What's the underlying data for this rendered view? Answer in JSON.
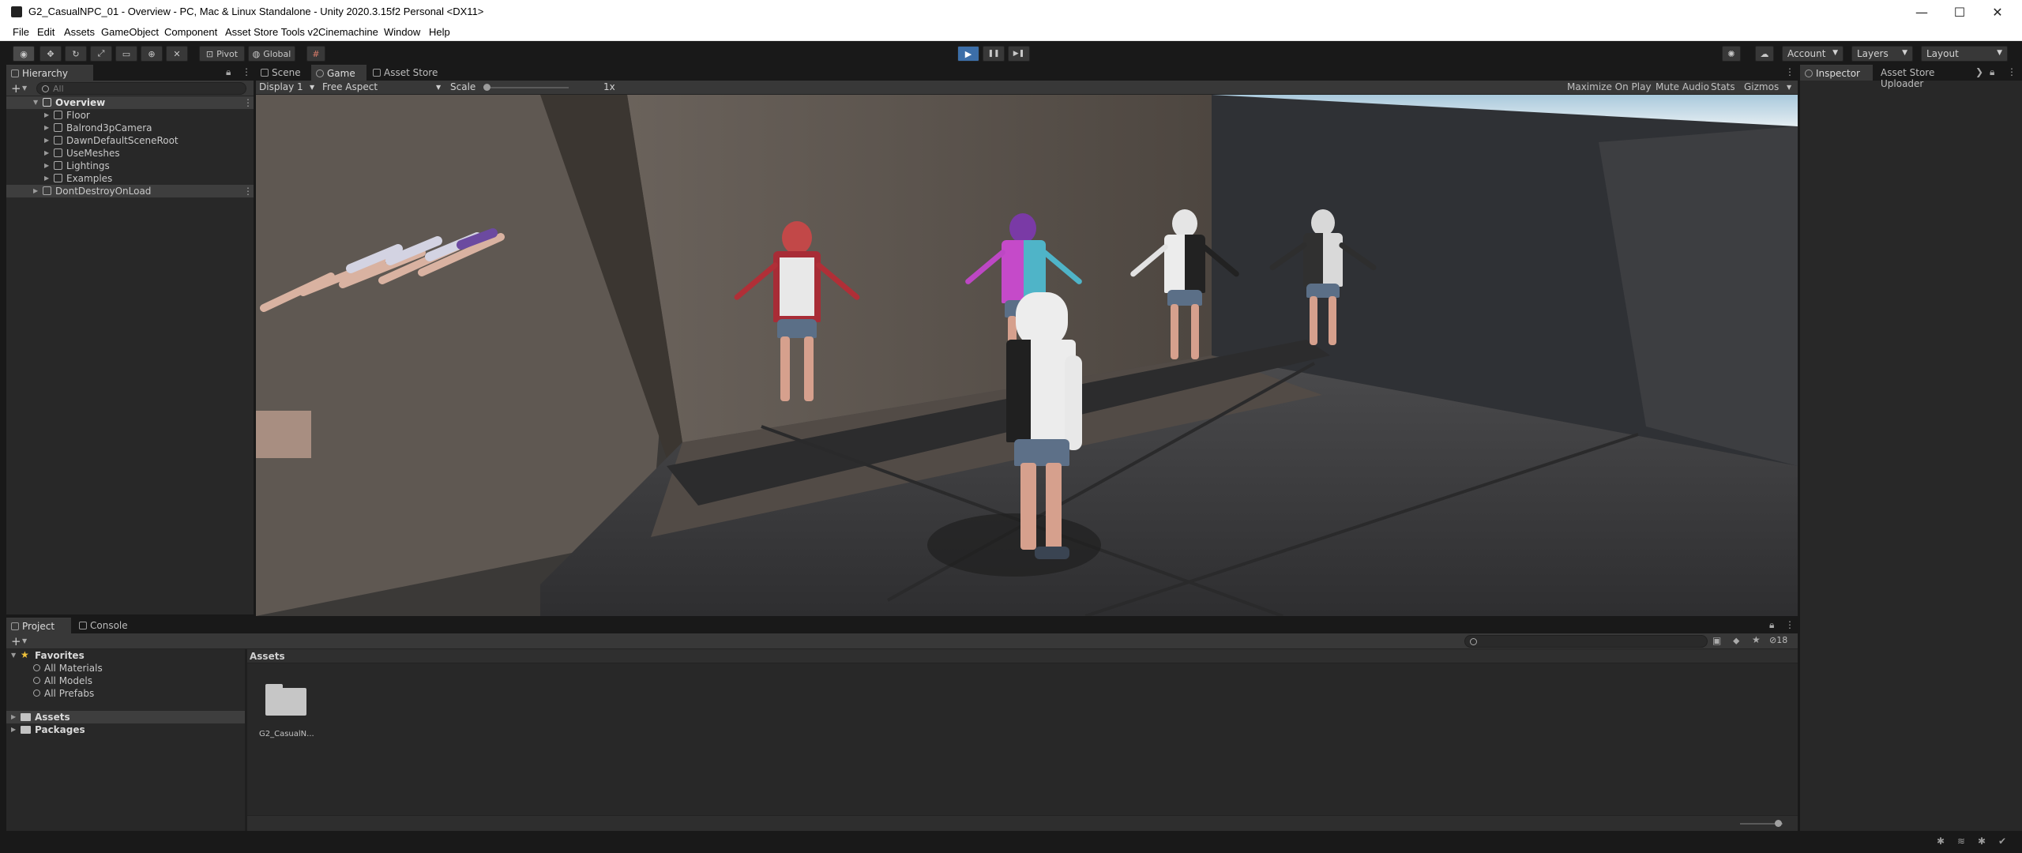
{
  "window": {
    "title": "G2_CasualNPC_01 - Overview - PC, Mac & Linux Standalone - Unity 2020.3.15f2 Personal <DX11>",
    "minimize": "—",
    "maximize": "☐",
    "close": "✕"
  },
  "menu": [
    "File",
    "Edit",
    "Assets",
    "GameObject",
    "Component",
    "Asset Store Tools v2",
    "Cinemachine",
    "Window",
    "Help"
  ],
  "toolbar": {
    "pivot": "Pivot",
    "global": "Global",
    "play_icon": "▶",
    "pause_icon": "❚❚",
    "step_icon": "▶❚",
    "account": "Account",
    "layers": "Layers",
    "layout": "Layout"
  },
  "hierarchy": {
    "tab": "Hierarchy",
    "search_placeholder": "All",
    "add": "+",
    "scene": "Overview",
    "items": [
      "Floor",
      "Balrond3pCamera",
      "DawnDefaultSceneRoot",
      "UseMeshes",
      "Lightings",
      "Examples"
    ],
    "dont_destroy": "DontDestroyOnLoad"
  },
  "scene_tabs": {
    "scene": "Scene",
    "game": "Game",
    "asset_store": "Asset Store"
  },
  "game_bar": {
    "display": "Display 1",
    "aspect": "Free Aspect",
    "scale_label": "Scale",
    "scale_value": "1x",
    "scale_fraction": 0.0,
    "maximize_on_play": "Maximize On Play",
    "mute_audio": "Mute Audio",
    "stats": "Stats",
    "gizmos": "Gizmos"
  },
  "inspector": {
    "tab": "Inspector",
    "uploader": "Asset Store Uploader"
  },
  "project": {
    "tab_project": "Project",
    "tab_console": "Console",
    "add": "+",
    "favorites": "Favorites",
    "fav_items": [
      "All Materials",
      "All Models",
      "All Prefabs"
    ],
    "roots": [
      "Assets",
      "Packages"
    ],
    "breadcrumb": "Assets",
    "folder_label": "G2_CasualN...",
    "hidden_count": "18"
  },
  "colors": {
    "accent_play": "#3c6ea8",
    "panel": "#282828",
    "toolbar": "#191919",
    "tab_selected": "#383838"
  }
}
